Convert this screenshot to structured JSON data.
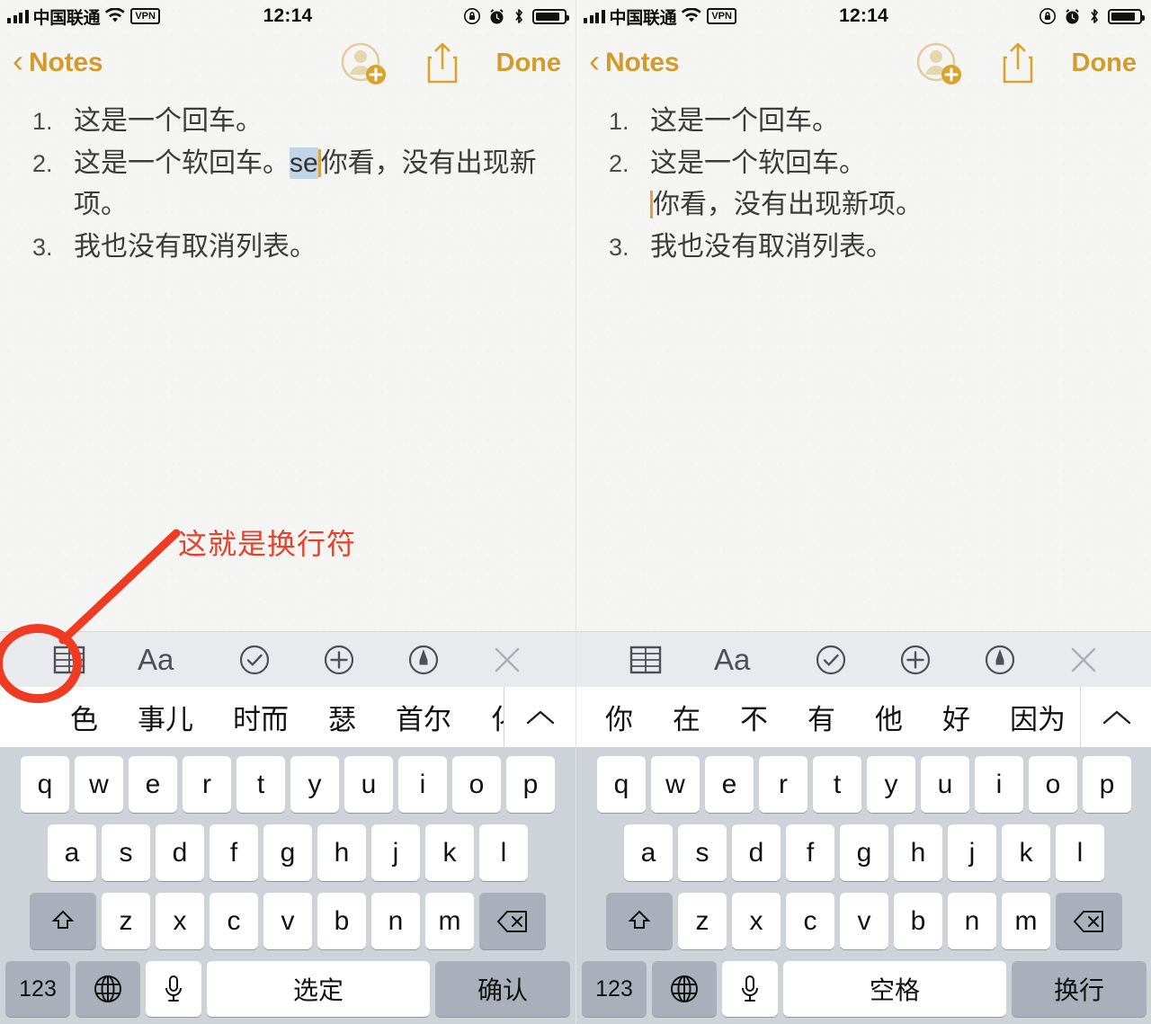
{
  "panes": [
    {
      "id": "left",
      "status": {
        "carrier": "中国联通",
        "wifi_icon": "wifi-icon",
        "vpn_label": "VPN",
        "time": "12:14",
        "rotation_lock_icon": "rotation-lock-icon",
        "alarm_icon": "alarm-clock-icon",
        "bluetooth_icon": "bluetooth-icon",
        "battery_icon": "battery-icon"
      },
      "nav": {
        "back_label": "Notes",
        "back_icon": "chevron-left-icon",
        "add_person_icon": "add-person-icon",
        "share_icon": "share-icon",
        "done_label": "Done"
      },
      "note": {
        "items": [
          {
            "num": "1.",
            "text": "这是一个回车。"
          },
          {
            "num": "2.",
            "text": "这是一个软回车。",
            "marked": "se",
            "after": "你看，没有出现新",
            "cont": "项。"
          },
          {
            "num": "3.",
            "text": "我也没有取消列表。"
          }
        ]
      },
      "keyboard": {
        "toolbar": [
          "table-icon",
          "text-format-icon",
          "checklist-icon",
          "add-attachment-icon",
          "markup-pen-icon",
          "close-keyboard-icon"
        ],
        "candidates": [
          "",
          "色",
          "事儿",
          "时而",
          "瑟",
          "首尔",
          "化"
        ],
        "expand_icon": "chevron-up-icon",
        "row1": [
          "q",
          "w",
          "e",
          "r",
          "t",
          "y",
          "u",
          "i",
          "o",
          "p"
        ],
        "row2": [
          "a",
          "s",
          "d",
          "f",
          "g",
          "h",
          "j",
          "k",
          "l"
        ],
        "row3": [
          "z",
          "x",
          "c",
          "v",
          "b",
          "n",
          "m"
        ],
        "shift_icon": "shift-icon",
        "backspace_icon": "backspace-icon",
        "num_label": "123",
        "globe_icon": "globe-icon",
        "mic_icon": "microphone-icon",
        "space_label": "选定",
        "return_label": "确认"
      }
    },
    {
      "id": "right",
      "status": {
        "carrier": "中国联通",
        "wifi_icon": "wifi-icon",
        "vpn_label": "VPN",
        "time": "12:14",
        "rotation_lock_icon": "rotation-lock-icon",
        "alarm_icon": "alarm-clock-icon",
        "bluetooth_icon": "bluetooth-icon",
        "battery_icon": "battery-icon"
      },
      "nav": {
        "back_label": "Notes",
        "back_icon": "chevron-left-icon",
        "add_person_icon": "add-person-icon",
        "share_icon": "share-icon",
        "done_label": "Done"
      },
      "note": {
        "items": [
          {
            "num": "1.",
            "text": "这是一个回车。"
          },
          {
            "num": "2.",
            "text": "这是一个软回车。",
            "cont": "你看，没有出现新项。"
          },
          {
            "num": "3.",
            "text": "我也没有取消列表。"
          }
        ]
      },
      "keyboard": {
        "toolbar": [
          "table-icon",
          "text-format-icon",
          "checklist-icon",
          "add-attachment-icon",
          "markup-pen-icon",
          "close-keyboard-icon"
        ],
        "candidates": [
          "你",
          "在",
          "不",
          "有",
          "他",
          "好",
          "因为"
        ],
        "expand_icon": "chevron-up-icon",
        "row1": [
          "q",
          "w",
          "e",
          "r",
          "t",
          "y",
          "u",
          "i",
          "o",
          "p"
        ],
        "row2": [
          "a",
          "s",
          "d",
          "f",
          "g",
          "h",
          "j",
          "k",
          "l"
        ],
        "row3": [
          "z",
          "x",
          "c",
          "v",
          "b",
          "n",
          "m"
        ],
        "shift_icon": "shift-icon",
        "backspace_icon": "backspace-icon",
        "num_label": "123",
        "globe_icon": "globe-icon",
        "mic_icon": "microphone-icon",
        "space_label": "空格",
        "return_label": "换行"
      }
    }
  ],
  "annotation": {
    "text": "这就是换行符",
    "color": "#e8402a",
    "arrow_icon": "arrow-pointer-icon",
    "circle_icon": "highlight-ellipse-icon"
  },
  "colors": {
    "accent": "#d39b2b",
    "caret": "#d9a441",
    "marked_text_bg": "#c3d4e6",
    "keyboard_bg": "#ced2d9",
    "toolbar_bg": "#e9eaee",
    "annotation_red": "#e8402a"
  }
}
